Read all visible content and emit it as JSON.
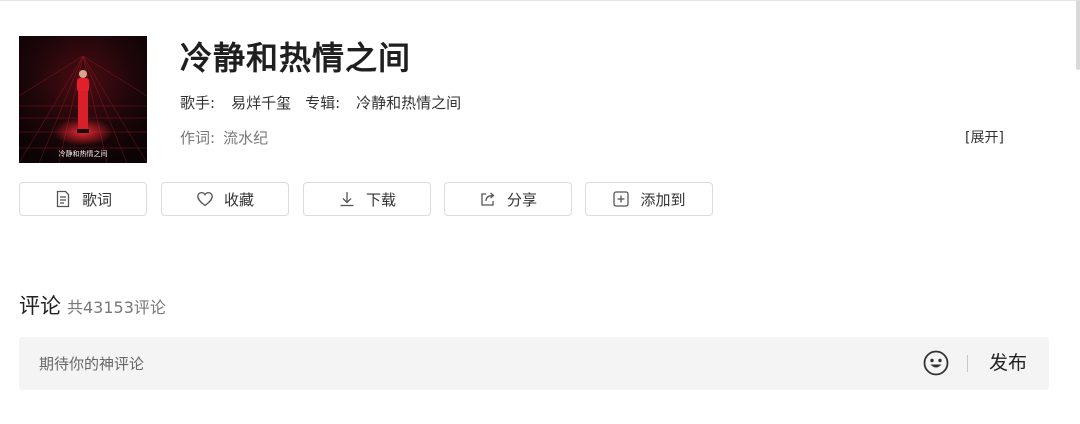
{
  "song": {
    "title": "冷静和热情之间",
    "singer_label": "歌手:",
    "singer": "易烊千玺",
    "album_label": "专辑:",
    "album": "冷静和热情之间",
    "lyricist_label": "作词:",
    "lyricist": "流水纪",
    "expand_label": "[展开]",
    "cover_text": "冷静和热情之间"
  },
  "actions": [
    {
      "label": "歌词",
      "icon": "lyrics-icon"
    },
    {
      "label": "收藏",
      "icon": "heart-icon"
    },
    {
      "label": "下载",
      "icon": "download-icon"
    },
    {
      "label": "分享",
      "icon": "share-icon"
    },
    {
      "label": "添加到",
      "icon": "add-square-icon"
    }
  ],
  "comments": {
    "title": "评论",
    "count_text": "共43153评论",
    "input_placeholder": "期待你的神评论",
    "emoji_icon": "smiley-icon",
    "publish_label": "发布"
  },
  "colors": {
    "title": "#1f1f1f",
    "muted": "#777777",
    "input_bg": "#f4f4f4",
    "border": "#dcdcdc",
    "cover_accent": "#e0212b"
  }
}
